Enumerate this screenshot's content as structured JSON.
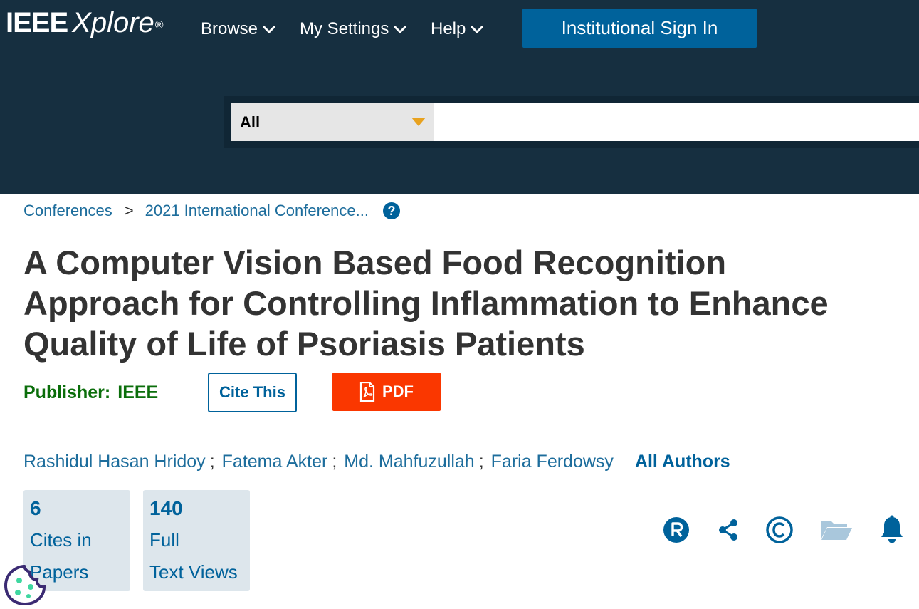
{
  "header": {
    "logo_main": "IEEE",
    "logo_sub": "Xplore",
    "logo_mark": "®",
    "nav": [
      {
        "label": "Browse"
      },
      {
        "label": "My Settings"
      },
      {
        "label": "Help"
      }
    ],
    "signin_label": "Institutional Sign In"
  },
  "search": {
    "scope_value": "All",
    "placeholder": ""
  },
  "breadcrumb": {
    "items": [
      "Conferences",
      "2021 International Conference..."
    ],
    "separator": ">",
    "help_icon": "?"
  },
  "article": {
    "title": "A Computer Vision Based Food Recognition Approach for Controlling Inflammation to Enhance Quality of Life of Psoriasis Patients",
    "publisher_label": "Publisher:",
    "publisher_name": "IEEE",
    "cite_label": "Cite This",
    "pdf_label": "PDF",
    "authors": [
      "Rashidul Hasan Hridoy",
      "Fatema Akter",
      "Md. Mahfuzullah",
      "Faria Ferdowsy"
    ],
    "author_separator": ";",
    "all_authors_label": "All Authors"
  },
  "metrics": [
    {
      "value": "6",
      "label_line1": "Cites in",
      "label_line2": "Papers"
    },
    {
      "value": "140",
      "label_line1": "Full",
      "label_line2": "Text Views"
    }
  ],
  "tools": {
    "icons": [
      "rights-r-icon",
      "share-icon",
      "copyright-icon",
      "folder-icon",
      "bell-icon"
    ],
    "accent": "#00629b"
  },
  "colors": {
    "header_bg": "#162f40",
    "signin_bg": "#00629b",
    "pdf_bg": "#fa3700",
    "publisher": "#0b6e0b",
    "link": "#1d6d9c",
    "caret": "#e8a21f"
  }
}
